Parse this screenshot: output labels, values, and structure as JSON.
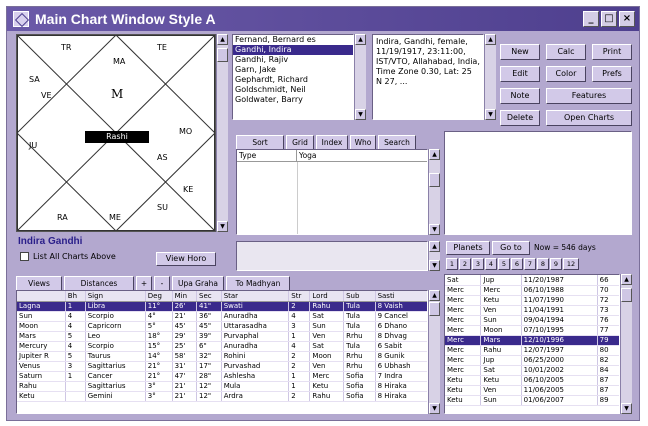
{
  "window": {
    "title": "Main Chart Window Style A",
    "controls": [
      "_",
      "□",
      "×"
    ]
  },
  "chart": {
    "center_label": "Rashi",
    "center_planet": "M",
    "house_marks": [
      "TR",
      "TE",
      "MA",
      "SA",
      "VE",
      "JU",
      "MO",
      "KE",
      "SU",
      "ME",
      "RA",
      "AS"
    ]
  },
  "people_list": {
    "items": [
      "Fernand, Bernard es",
      "Gandhi, Indira",
      "Gandhi, Rajiv",
      "Garn, Jake",
      "Gephardt, Richard",
      "Goldschmidt, Neil",
      "Goldwater, Barry"
    ],
    "selected_index": 1
  },
  "info_box": {
    "text": "Indira, Gandhi, female, 11/19/1917, 23:11:00, IST/VTO, Allahabad, India, Time Zone 0.30, Lat: 25 N 27, ..."
  },
  "right_buttons": [
    "New",
    "Calc",
    "Print",
    "Edit",
    "Color",
    "Prefs",
    "Note",
    "Features",
    "Delete",
    "Open Charts"
  ],
  "tabs_top": [
    "Sort",
    "Grid",
    "Index",
    "Who",
    "Search"
  ],
  "type_table": {
    "headers": [
      "Type",
      "Yoga"
    ]
  },
  "person": {
    "name": "Indira Gandhi",
    "list_all_label": "List All Charts Above",
    "view_horo_label": "View Horo"
  },
  "bottom_tabs": [
    "Views",
    "Distances",
    "+",
    "-",
    "Upa Graha",
    "To Madhyan"
  ],
  "planets_table": {
    "headers": [
      "",
      "Bh",
      "Sign",
      "Deg",
      "Min",
      "Sec",
      "Star",
      "Str",
      "Lord",
      "Sub",
      "Sasti"
    ],
    "rows": [
      [
        "Lagna",
        "1",
        "Libra",
        "11°",
        "26'",
        "41\"",
        "Swati",
        "2",
        "Rahu",
        "Tula",
        "8 Vaish"
      ],
      [
        "Sun",
        "4",
        "Scorpio",
        "4°",
        "21'",
        "36\"",
        "Anuradha",
        "4",
        "Sat",
        "Tula",
        "9 Cancel"
      ],
      [
        "Moon",
        "4",
        "Capricorn",
        "5°",
        "45'",
        "45\"",
        "Uttarasadha",
        "3",
        "Sun",
        "Tula",
        "6 Dhano"
      ],
      [
        "Mars",
        "5",
        "Leo",
        "18°",
        "29'",
        "39\"",
        "Purvaphal",
        "1",
        "Ven",
        "Rrhu",
        "8 Dhvag"
      ],
      [
        "Mercury",
        "4",
        "Scorpio",
        "15°",
        "25'",
        "6\"",
        "Anuradha",
        "4",
        "Sat",
        "Tula",
        "6 Sabit"
      ],
      [
        "Jupiter R",
        "5",
        "Taurus",
        "14°",
        "58'",
        "32\"",
        "Rohini",
        "2",
        "Moon",
        "Rrhu",
        "8 Gunik"
      ],
      [
        "Venus",
        "3",
        "Sagittarius",
        "21°",
        "31'",
        "17\"",
        "Purvashad",
        "2",
        "Ven",
        "Rrhu",
        "6 Ubhash"
      ],
      [
        "Saturn",
        "1",
        "Cancer",
        "21°",
        "47'",
        "28\"",
        "Ashlesha",
        "1",
        "Merc",
        "Sofia",
        "7 Indra"
      ],
      [
        "Rahu",
        "",
        "Sagittarius",
        "3°",
        "21'",
        "12\"",
        "Mula",
        "1",
        "Ketu",
        "Sofia",
        "8 Hiraka"
      ],
      [
        "Ketu",
        "",
        "Gemini",
        "3°",
        "21'",
        "12\"",
        "Ardra",
        "2",
        "Rahu",
        "Sofia",
        "8 Hiraka"
      ]
    ],
    "selected_index": 0
  },
  "planets_panel": {
    "planets_btn": "Planets",
    "goto_btn": "Go to",
    "now_text": "Now = 546 days",
    "levels": [
      "1",
      "2",
      "3",
      "4",
      "5",
      "6",
      "7",
      "8",
      "9",
      "12"
    ]
  },
  "dasha_table": {
    "rows": [
      [
        "Sat",
        "Jup",
        "11/20/1987",
        "66"
      ],
      [
        "Merc",
        "Merc",
        "06/10/1988",
        "70"
      ],
      [
        "Merc",
        "Ketu",
        "11/07/1990",
        "72"
      ],
      [
        "Merc",
        "Ven",
        "11/04/1991",
        "73"
      ],
      [
        "Merc",
        "Sun",
        "09/04/1994",
        "76"
      ],
      [
        "Merc",
        "Moon",
        "07/10/1995",
        "77"
      ],
      [
        "Merc",
        "Mars",
        "12/10/1996",
        "79"
      ],
      [
        "Merc",
        "Rahu",
        "12/07/1997",
        "80"
      ],
      [
        "Merc",
        "Jup",
        "06/25/2000",
        "82"
      ],
      [
        "Merc",
        "Sat",
        "10/01/2002",
        "84"
      ],
      [
        "Ketu",
        "Ketu",
        "06/10/2005",
        "87"
      ],
      [
        "Ketu",
        "Ven",
        "11/06/2005",
        "87"
      ],
      [
        "Ketu",
        "Sun",
        "01/06/2007",
        "89"
      ]
    ],
    "selected_index": 6
  },
  "colors": {
    "window_bg": "#b3a8cf",
    "title_bg": "#5a4a9c",
    "selection": "#3a2a8c",
    "name_text": "#2a1f8a"
  }
}
